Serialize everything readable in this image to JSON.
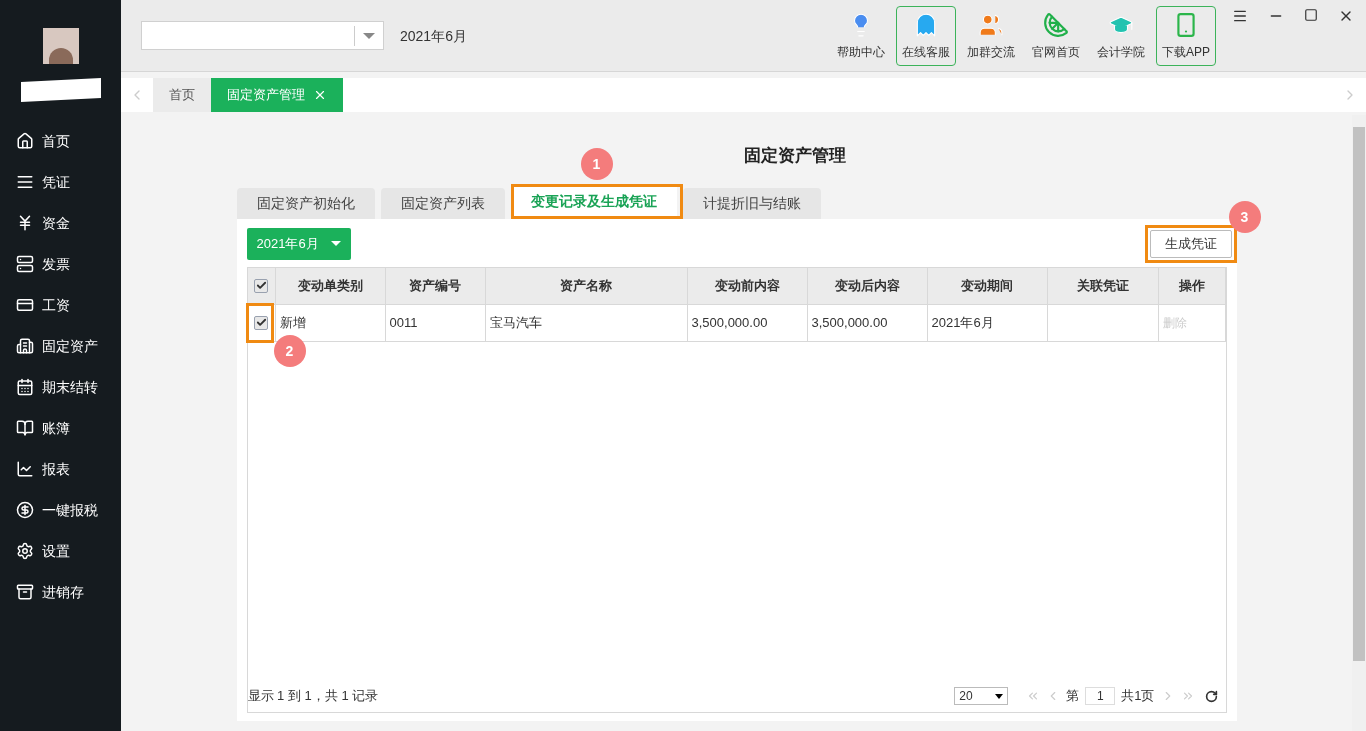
{
  "sidebar": {
    "items": [
      {
        "label": "首页",
        "kind": "home"
      },
      {
        "label": "凭证",
        "kind": "voucher"
      },
      {
        "label": "资金",
        "kind": "fund"
      },
      {
        "label": "发票",
        "kind": "invoice"
      },
      {
        "label": "工资",
        "kind": "salary"
      },
      {
        "label": "固定资产",
        "kind": "asset"
      },
      {
        "label": "期末结转",
        "kind": "closing"
      },
      {
        "label": "账簿",
        "kind": "ledger"
      },
      {
        "label": "报表",
        "kind": "report"
      },
      {
        "label": "一键报税",
        "kind": "tax"
      },
      {
        "label": "设置",
        "kind": "settings"
      },
      {
        "label": "进销存",
        "kind": "inventory"
      }
    ]
  },
  "period": "2021年6月",
  "toolbar": [
    {
      "label": "帮助中心",
      "kind": "help",
      "outlined": false
    },
    {
      "label": "在线客服",
      "kind": "service",
      "outlined": true
    },
    {
      "label": "加群交流",
      "kind": "group",
      "outlined": false
    },
    {
      "label": "官网首页",
      "kind": "site",
      "outlined": false
    },
    {
      "label": "会计学院",
      "kind": "academy",
      "outlined": false
    },
    {
      "label": "下载APP",
      "kind": "app",
      "outlined": true
    }
  ],
  "page_tabs": [
    {
      "label": "首页",
      "selected": false,
      "closable": false
    },
    {
      "label": "固定资产管理",
      "selected": true,
      "closable": true
    }
  ],
  "title": "固定资产管理",
  "tabs": [
    {
      "label": "固定资产初始化",
      "selected": false
    },
    {
      "label": "固定资产列表",
      "selected": false
    },
    {
      "label": "变更记录及生成凭证",
      "selected": true
    },
    {
      "label": "计提折旧与结账",
      "selected": false
    }
  ],
  "period_button": "2021年6月",
  "generate_button": "生成凭证",
  "table": {
    "header_checked": true,
    "columns": [
      "变动单类别",
      "资产编号",
      "资产名称",
      "变动前内容",
      "变动后内容",
      "变动期间",
      "关联凭证",
      "操作"
    ],
    "rows": [
      {
        "checked": true,
        "cells": [
          "新增",
          "0011",
          "宝马汽车",
          "3,500,000.00",
          "3,500,000.00",
          "2021年6月",
          ""
        ],
        "action": "删除",
        "action_disabled": true
      }
    ]
  },
  "pager": {
    "summary": "显示 1 到 1，共 1 记录",
    "page_size": "20",
    "page_prefix": "第",
    "page": "1",
    "page_suffix": "共1页"
  },
  "annotations": [
    {
      "label": "1"
    },
    {
      "label": "2"
    },
    {
      "label": "3"
    }
  ]
}
